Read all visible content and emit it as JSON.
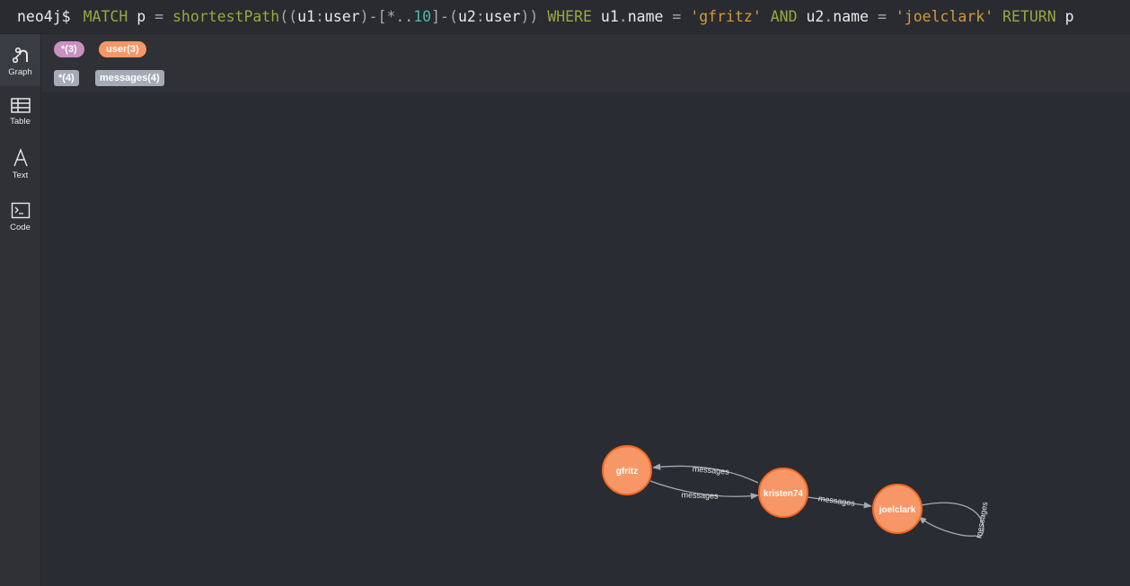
{
  "query": {
    "prompt": "neo4j$",
    "tokens": [
      {
        "t": "MATCH",
        "c": "kw"
      },
      {
        "t": " ",
        "c": "id"
      },
      {
        "t": "p",
        "c": "id"
      },
      {
        "t": " = ",
        "c": "op"
      },
      {
        "t": "shortestPath",
        "c": "fn"
      },
      {
        "t": "((",
        "c": "op"
      },
      {
        "t": "u1",
        "c": "id"
      },
      {
        "t": ":",
        "c": "op"
      },
      {
        "t": "user",
        "c": "lbl"
      },
      {
        "t": ")-[",
        "c": "op"
      },
      {
        "t": "*..",
        "c": "op"
      },
      {
        "t": "10",
        "c": "num"
      },
      {
        "t": "]-(",
        "c": "op"
      },
      {
        "t": "u2",
        "c": "id"
      },
      {
        "t": ":",
        "c": "op"
      },
      {
        "t": "user",
        "c": "lbl"
      },
      {
        "t": ")) ",
        "c": "op"
      },
      {
        "t": "WHERE",
        "c": "kw"
      },
      {
        "t": " u1",
        "c": "id"
      },
      {
        "t": ".",
        "c": "op"
      },
      {
        "t": "name",
        "c": "id"
      },
      {
        "t": " = ",
        "c": "op"
      },
      {
        "t": "'gfritz'",
        "c": "str"
      },
      {
        "t": " AND",
        "c": "kw"
      },
      {
        "t": " u2",
        "c": "id"
      },
      {
        "t": ".",
        "c": "op"
      },
      {
        "t": "name",
        "c": "id"
      },
      {
        "t": " = ",
        "c": "op"
      },
      {
        "t": "'joelclark'",
        "c": "str"
      },
      {
        "t": " RETURN",
        "c": "kw"
      },
      {
        "t": " p",
        "c": "id"
      }
    ]
  },
  "sidebar": {
    "items": [
      {
        "label": "Graph",
        "icon": "graph-icon"
      },
      {
        "label": "Table",
        "icon": "table-icon"
      },
      {
        "label": "Text",
        "icon": "text-icon"
      },
      {
        "label": "Code",
        "icon": "code-icon"
      }
    ]
  },
  "legend": {
    "node_labels": [
      {
        "text": "*(3)",
        "color": "#c990c0"
      },
      {
        "text": "user(3)",
        "color": "#f79767"
      }
    ],
    "rel_types": [
      {
        "text": "*(4)",
        "color": "#a5abb6"
      },
      {
        "text": "messages(4)",
        "color": "#a5abb6"
      }
    ]
  },
  "graph": {
    "node_color": "#f79767",
    "node_border": "#f36924",
    "edge_color": "#a5abb6",
    "nodes": [
      {
        "id": "gfritz",
        "label": "gfritz"
      },
      {
        "id": "kristen74",
        "label": "kristen74"
      },
      {
        "id": "joelclark",
        "label": "joelclark"
      }
    ],
    "edges": [
      {
        "from": "kristen74",
        "to": "gfritz",
        "label": "messages"
      },
      {
        "from": "gfritz",
        "to": "kristen74",
        "label": "messages"
      },
      {
        "from": "kristen74",
        "to": "joelclark",
        "label": "messages"
      },
      {
        "from": "joelclark",
        "to": "joelclark",
        "label": "messages"
      }
    ]
  }
}
